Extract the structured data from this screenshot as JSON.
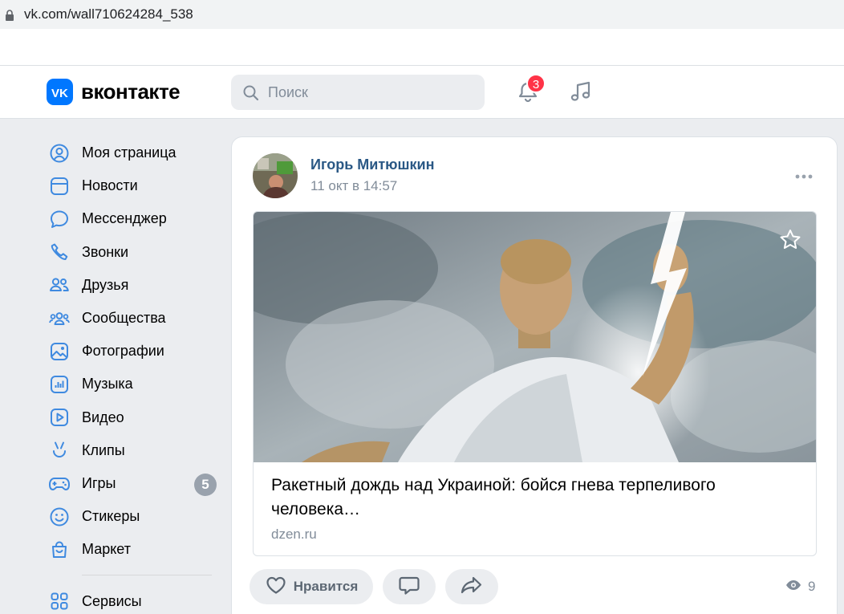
{
  "browser": {
    "url": "vk.com/wall710624284_538"
  },
  "header": {
    "logo_text": "вконтакте",
    "search_placeholder": "Поиск",
    "notifications_count": "3"
  },
  "sidebar": {
    "items": [
      {
        "label": "Моя страница",
        "icon": "user-circle-icon"
      },
      {
        "label": "Новости",
        "icon": "news-icon"
      },
      {
        "label": "Мессенджер",
        "icon": "message-icon"
      },
      {
        "label": "Звонки",
        "icon": "phone-icon"
      },
      {
        "label": "Друзья",
        "icon": "friends-icon"
      },
      {
        "label": "Сообщества",
        "icon": "communities-icon"
      },
      {
        "label": "Фотографии",
        "icon": "photo-icon"
      },
      {
        "label": "Музыка",
        "icon": "music-icon"
      },
      {
        "label": "Видео",
        "icon": "video-icon"
      },
      {
        "label": "Клипы",
        "icon": "clips-icon"
      },
      {
        "label": "Игры",
        "icon": "gamepad-icon",
        "count": "5"
      },
      {
        "label": "Стикеры",
        "icon": "smile-icon"
      },
      {
        "label": "Маркет",
        "icon": "market-bag-icon"
      }
    ],
    "services_label": "Сервисы"
  },
  "post": {
    "author": "Игорь Митюшкин",
    "date": "11 окт в 14:57",
    "snippet": {
      "title": "Ракетный дождь над Украиной: бойся гнева терпеливого человека…",
      "source": "dzen.ru"
    },
    "like_label": "Нравится",
    "views": "9"
  },
  "colors": {
    "accent": "#0077ff",
    "author_link": "#2a5885",
    "badge": "#ff3347",
    "background": "#ebedf0"
  }
}
